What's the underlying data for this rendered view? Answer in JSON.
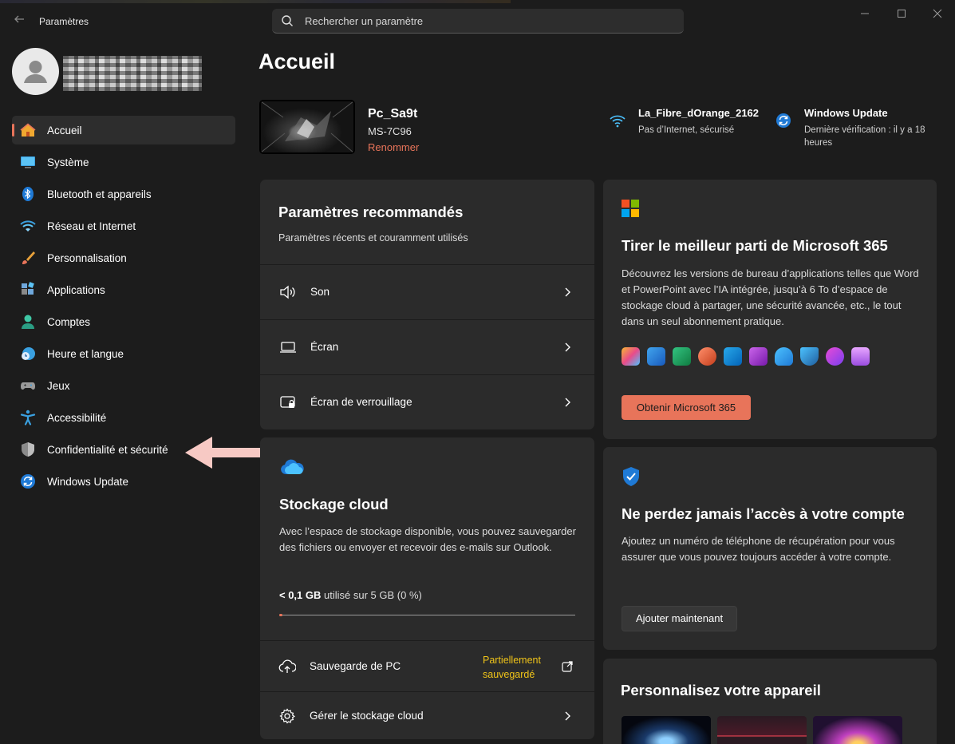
{
  "window": {
    "app_title": "Paramètres",
    "search_placeholder": "Rechercher un paramètre"
  },
  "sidebar": {
    "items": [
      {
        "label": "Accueil",
        "icon": "home-icon",
        "active": true
      },
      {
        "label": "Système",
        "icon": "system-icon"
      },
      {
        "label": "Bluetooth et appareils",
        "icon": "bluetooth-icon"
      },
      {
        "label": "Réseau et Internet",
        "icon": "wifi-icon"
      },
      {
        "label": "Personnalisation",
        "icon": "brush-icon"
      },
      {
        "label": "Applications",
        "icon": "apps-icon"
      },
      {
        "label": "Comptes",
        "icon": "account-icon"
      },
      {
        "label": "Heure et langue",
        "icon": "clock-globe-icon"
      },
      {
        "label": "Jeux",
        "icon": "gamepad-icon"
      },
      {
        "label": "Accessibilité",
        "icon": "accessibility-icon"
      },
      {
        "label": "Confidentialité et sécurité",
        "icon": "shield-icon"
      },
      {
        "label": "Windows Update",
        "icon": "update-icon"
      }
    ]
  },
  "main": {
    "title": "Accueil",
    "device": {
      "name": "Pc_Sa9t",
      "model": "MS-7C96",
      "rename": "Renommer"
    },
    "network": {
      "name": "La_Fibre_dOrange_2162",
      "status": "Pas d’Internet, sécurisé"
    },
    "update": {
      "title": "Windows Update",
      "status": "Dernière vérification : il y a 18 heures"
    },
    "recommended": {
      "title": "Paramètres recommandés",
      "subtitle": "Paramètres récents et couramment utilisés",
      "rows": [
        {
          "label": "Son",
          "icon": "speaker-icon"
        },
        {
          "label": "Écran",
          "icon": "laptop-icon"
        },
        {
          "label": "Écran de verrouillage",
          "icon": "lock-screen-icon"
        }
      ]
    },
    "cloud": {
      "title": "Stockage cloud",
      "description": "Avec l’espace de stockage disponible, vous pouvez sauvegarder des fichiers ou envoyer et recevoir des e-mails sur Outlook.",
      "usage_bold": "< 0,1 GB",
      "usage_rest": "utilisé sur 5 GB (0 %)",
      "usage_percent": 0,
      "backup_label": "Sauvegarde de PC",
      "backup_status": "Partiellement sauvegardé",
      "manage_label": "Gérer le stockage cloud"
    },
    "ms365": {
      "title": "Tirer le meilleur parti de Microsoft 365",
      "description": "Découvrez les versions de bureau d’applications telles que Word et PowerPoint avec l’IA intégrée, jusqu’à 6 To d’espace de stockage cloud à partager, une sécurité avancée, etc., le tout dans un seul abonnement pratique.",
      "button": "Obtenir Microsoft 365"
    },
    "account": {
      "title": "Ne perdez jamais l’accès à votre compte",
      "description": "Ajoutez un numéro de téléphone de récupération pour vous assurer que vous pouvez toujours accéder à votre compte.",
      "button": "Ajouter maintenant"
    },
    "personalize": {
      "title": "Personnalisez votre appareil"
    }
  },
  "colors": {
    "accent": "#e8745a",
    "background": "#1c1c1c",
    "card": "#2b2b2b",
    "warning_text": "#f0c419"
  }
}
